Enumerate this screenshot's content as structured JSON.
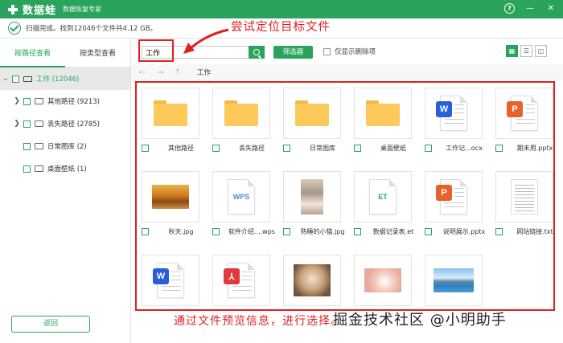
{
  "app": {
    "name": "数据蛙",
    "subtitle": "数据恢复专家",
    "controls": {
      "help": "?",
      "minimize": "—",
      "close": "✕"
    }
  },
  "status": {
    "text": "扫描完成。找到12046个文件共4.12 GB。"
  },
  "annotations": {
    "top": "尝试定位目标文件",
    "bottom": "通过文件预览信息，进行选择。",
    "watermark": "掘金技术社区 @小明助手"
  },
  "sidebar": {
    "tabs": [
      {
        "label": "按路径查看",
        "active": true
      },
      {
        "label": "按类型查看",
        "active": false
      }
    ],
    "tree": [
      {
        "label": "工作 (12046)",
        "expanded": true,
        "level": 0,
        "icon": "drive-icon"
      },
      {
        "label": "其他路径 (9213)",
        "expanded": false,
        "level": 1,
        "icon": "folder-icon"
      },
      {
        "label": "丢失路径 (2785)",
        "expanded": false,
        "level": 1,
        "icon": "folder-icon"
      },
      {
        "label": "日常图库 (2)",
        "level": 1,
        "icon": "folder-icon"
      },
      {
        "label": "桌面壁纸 (1)",
        "level": 1,
        "icon": "folder-icon"
      }
    ],
    "back_label": "返回"
  },
  "toolbar": {
    "search_value": "工作",
    "filter_label": "筛选器",
    "deleted_only_label": "仅显示删除项"
  },
  "nav": {
    "back": "←",
    "forward": "→",
    "up": "↑",
    "crumb": "工作"
  },
  "colors": {
    "accent": "#2aa45c",
    "annotation": "#e02020",
    "word": "#2b5fd9",
    "ppt": "#e8602a",
    "pdf": "#e0393e",
    "wps": "#4d86e8",
    "et": "#1fa67a"
  },
  "files": [
    {
      "name": "其他路径",
      "kind": "folder"
    },
    {
      "name": "丢失路径",
      "kind": "folder"
    },
    {
      "name": "日常图库",
      "kind": "folder"
    },
    {
      "name": "桌面壁纸",
      "kind": "folder"
    },
    {
      "name": "工作记...ocx",
      "kind": "word"
    },
    {
      "name": "期末用.pptx",
      "kind": "ppt"
    },
    {
      "name": "秋天.jpg",
      "kind": "photo-autumn"
    },
    {
      "name": "软件介绍....wps",
      "kind": "wps"
    },
    {
      "name": "熟睡的小猫.jpg",
      "kind": "photo-cat"
    },
    {
      "name": "数据记录表.et",
      "kind": "et"
    },
    {
      "name": "说明展示.pptx",
      "kind": "ppt"
    },
    {
      "name": "网站链接.txt",
      "kind": "txt"
    },
    {
      "name": "",
      "kind": "word"
    },
    {
      "name": "",
      "kind": "pdf"
    },
    {
      "name": "",
      "kind": "photo-kitten"
    },
    {
      "name": "",
      "kind": "photo-rabbit"
    },
    {
      "name": "",
      "kind": "photo-lake"
    }
  ]
}
